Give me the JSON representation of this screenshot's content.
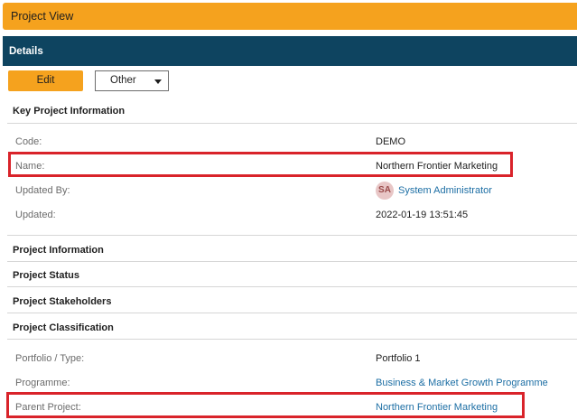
{
  "header": {
    "title": "Project View"
  },
  "details": {
    "title": "Details"
  },
  "toolbar": {
    "edit_label": "Edit",
    "other_label": "Other"
  },
  "sections": {
    "key_info": "Key Project Information",
    "project_information": "Project Information",
    "project_status": "Project Status",
    "project_stakeholders": "Project Stakeholders",
    "project_classification": "Project Classification"
  },
  "key_fields": {
    "code": {
      "label": "Code:",
      "value": "DEMO"
    },
    "name": {
      "label": "Name:",
      "value": "Northern Frontier Marketing"
    },
    "updated_by": {
      "label": "Updated By:",
      "initials": "SA",
      "value": "System Administrator"
    },
    "updated": {
      "label": "Updated:",
      "value": "2022-01-19 13:51:45"
    }
  },
  "classification_fields": {
    "portfolio": {
      "label": "Portfolio / Type:",
      "value": "Portfolio 1"
    },
    "programme": {
      "label": "Programme:",
      "value": "Business & Market Growth Programme"
    },
    "parent_project": {
      "label": "Parent Project:",
      "value": "Northern Frontier Marketing"
    }
  },
  "colors": {
    "accent": "#f5a21e",
    "header_dark": "#0e4460",
    "link": "#1c6ea4",
    "highlight": "#d9232a"
  }
}
